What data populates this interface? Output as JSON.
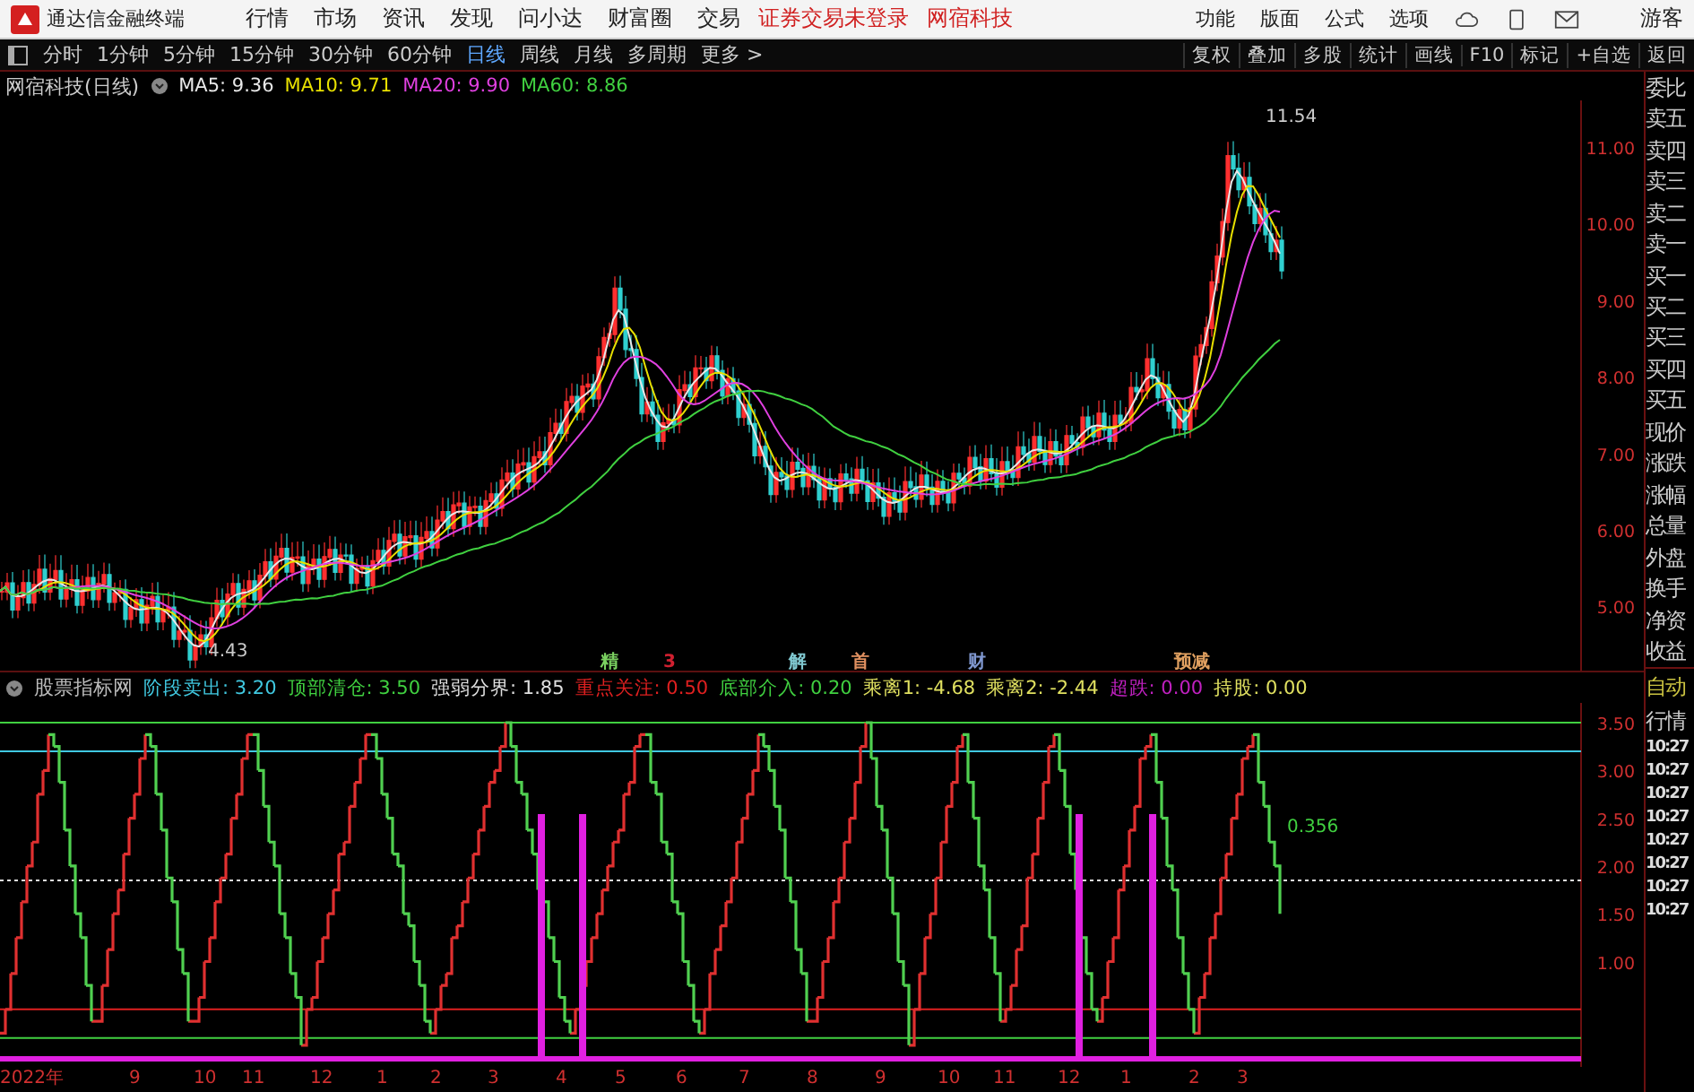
{
  "app": {
    "title": "通达信金融终端",
    "menus": [
      "行情",
      "市场",
      "资讯",
      "发现",
      "问小达",
      "财富圈",
      "交易"
    ],
    "notices": [
      "证券交易未登录",
      "网宿科技"
    ],
    "actions": [
      "功能",
      "版面",
      "公式",
      "选项"
    ],
    "user": "游客"
  },
  "periods": [
    {
      "label": "分时",
      "selected": false
    },
    {
      "label": "1分钟",
      "selected": false
    },
    {
      "label": "5分钟",
      "selected": false
    },
    {
      "label": "15分钟",
      "selected": false
    },
    {
      "label": "30分钟",
      "selected": false
    },
    {
      "label": "60分钟",
      "selected": false
    },
    {
      "label": "日线",
      "selected": true
    },
    {
      "label": "周线",
      "selected": false
    },
    {
      "label": "月线",
      "selected": false
    },
    {
      "label": "多周期",
      "selected": false
    },
    {
      "label": "更多 >",
      "selected": false
    }
  ],
  "tools": [
    "复权",
    "叠加",
    "多股",
    "统计",
    "画线",
    "F10",
    "标记",
    "+自选",
    "返回"
  ],
  "price_chart": {
    "title": "网宿科技(日线)",
    "averages": [
      {
        "label": "MA5: 9.36",
        "color": "#e8e8e8"
      },
      {
        "label": "MA10: 9.71",
        "color": "#e8e000"
      },
      {
        "label": "MA20: 9.90",
        "color": "#e040e0"
      },
      {
        "label": "MA60: 8.86",
        "color": "#40d040"
      }
    ],
    "yticks": [
      "11.00",
      "10.00",
      "9.00",
      "8.00",
      "7.00",
      "6.00",
      "5.00"
    ],
    "high": "11.54",
    "low": "4.43",
    "events": [
      {
        "label": "精",
        "color": "#7ad060"
      },
      {
        "label": "3",
        "color": "#d02030"
      },
      {
        "label": "解",
        "color": "#80c8d0"
      },
      {
        "label": "首",
        "color": "#e09060"
      },
      {
        "label": "财",
        "color": "#8098d0"
      },
      {
        "label": "预减",
        "color": "#e0a060"
      }
    ]
  },
  "indicator": {
    "name": "股票指标网",
    "params": [
      {
        "label": "阶段卖出: 3.20",
        "color": "#40c8e0"
      },
      {
        "label": "顶部清仓: 3.50",
        "color": "#40d040"
      },
      {
        "label": "强弱分界: 1.85",
        "color": "#e0e0e0"
      },
      {
        "label": "重点关注: 0.50",
        "color": "#e02020"
      },
      {
        "label": "底部介入: 0.20",
        "color": "#40d040"
      },
      {
        "label": "乘离1: -4.68",
        "color": "#e0e060"
      },
      {
        "label": "乘离2: -2.44",
        "color": "#e0e060"
      },
      {
        "label": "超跌: 0.00",
        "color": "#c020c0"
      },
      {
        "label": "持股: 0.00",
        "color": "#e0e060"
      }
    ],
    "yticks": [
      "3.50",
      "3.00",
      "2.50",
      "2.00",
      "1.50",
      "1.00"
    ],
    "reading": "0.356"
  },
  "dates": [
    "2022年",
    "9",
    "10",
    "11",
    "12",
    "1",
    "2",
    "3",
    "4",
    "5",
    "6",
    "7",
    "8",
    "9",
    "10",
    "11",
    "12",
    "1",
    "2",
    "3"
  ],
  "quote_panel": [
    "委比",
    "卖五",
    "卖四",
    "卖三",
    "卖二",
    "卖一",
    "买一",
    "买二",
    "买三",
    "买四",
    "买五",
    "现价",
    "涨跌",
    "涨幅",
    "总量",
    "外盘",
    "换手",
    "净资",
    "收益"
  ],
  "trade_panel": {
    "mode": "自动",
    "label": "行情",
    "times": [
      "10:27",
      "10:27",
      "10:27",
      "10:27",
      "10:27",
      "10:27",
      "10:27",
      "10:27"
    ]
  }
}
